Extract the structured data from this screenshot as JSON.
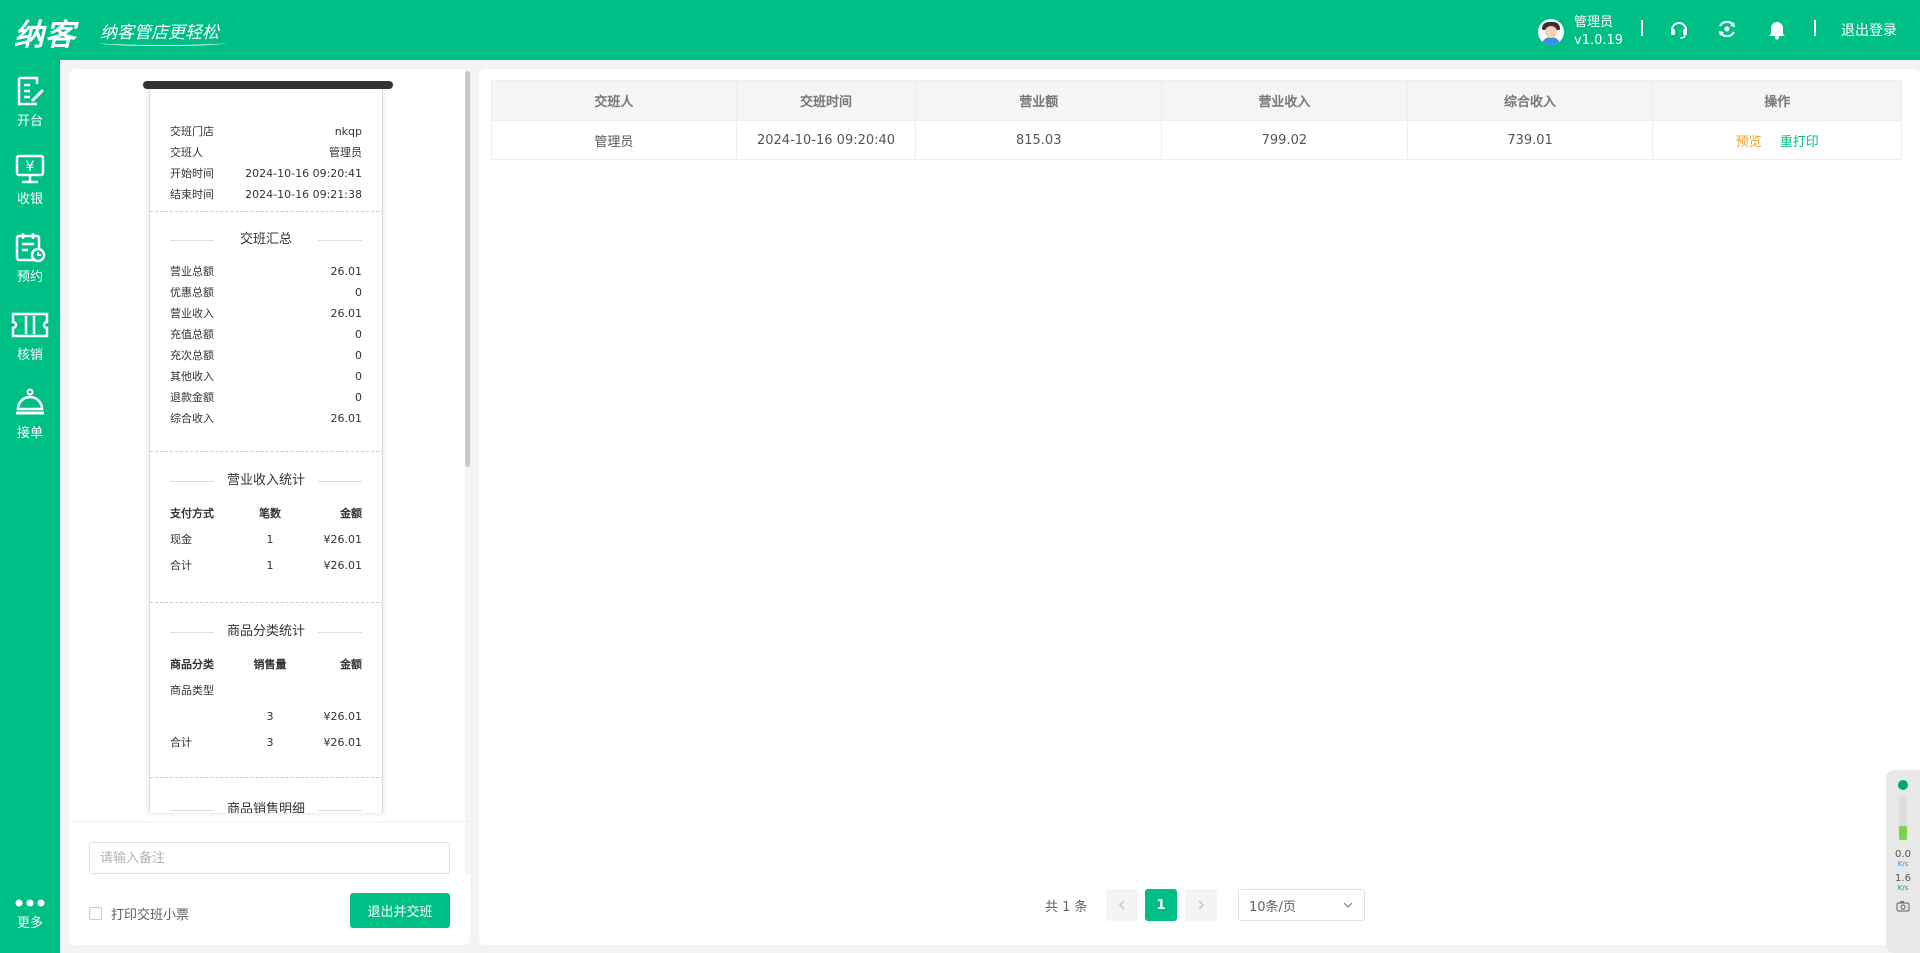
{
  "header": {
    "logo_text": "纳客",
    "slogan": "纳客管店更轻松",
    "user_name": "管理员",
    "version": "v1.0.19",
    "logout_label": "退出登录"
  },
  "sidebar": {
    "items": [
      {
        "label": "开台",
        "icon": "table-edit-icon"
      },
      {
        "label": "收银",
        "icon": "cashier-icon"
      },
      {
        "label": "预约",
        "icon": "reservation-icon"
      },
      {
        "label": "核销",
        "icon": "ticket-icon"
      },
      {
        "label": "接单",
        "icon": "bell-service-icon"
      }
    ],
    "more_label": "更多"
  },
  "receipt": {
    "info": [
      {
        "label": "交班门店",
        "value": "nkqp"
      },
      {
        "label": "交班人",
        "value": "管理员"
      },
      {
        "label": "开始时间",
        "value": "2024-10-16 09:20:41"
      },
      {
        "label": "结束时间",
        "value": "2024-10-16 09:21:38"
      }
    ],
    "summary_title": "交班汇总",
    "summary": [
      {
        "label": "营业总额",
        "value": "26.01"
      },
      {
        "label": "优惠总额",
        "value": "0"
      },
      {
        "label": "营业收入",
        "value": "26.01"
      },
      {
        "label": "充值总额",
        "value": "0"
      },
      {
        "label": "充次总额",
        "value": "0"
      },
      {
        "label": "其他收入",
        "value": "0"
      },
      {
        "label": "退款金额",
        "value": "0"
      },
      {
        "label": "综合收入",
        "value": "26.01"
      }
    ],
    "income_title": "营业收入统计",
    "income_headers": [
      "支付方式",
      "笔数",
      "金额"
    ],
    "income_rows": [
      [
        "现金",
        "1",
        "¥26.01"
      ],
      [
        "合计",
        "1",
        "¥26.01"
      ]
    ],
    "category_title": "商品分类统计",
    "category_headers": [
      "商品分类",
      "销售量",
      "金额"
    ],
    "category_group": "商品类型",
    "category_rows": [
      [
        "",
        "3",
        "¥26.01"
      ],
      [
        "合计",
        "3",
        "¥26.01"
      ]
    ],
    "sales_title": "商品销售明细"
  },
  "form": {
    "remark_placeholder": "请输入备注",
    "print_label": "打印交班小票",
    "print_checked": false,
    "exit_button": "退出并交班"
  },
  "table": {
    "headers": [
      "交班人",
      "交班时间",
      "营业额",
      "营业收入",
      "综合收入",
      "操作"
    ],
    "rows": [
      {
        "person": "管理员",
        "time": "2024-10-16 09:20:40",
        "turnover": "815.03",
        "revenue": "799.02",
        "total": "739.01",
        "preview": "预览",
        "reprint": "重打印"
      }
    ]
  },
  "pagination": {
    "total_text": "共 1 条",
    "current_page": "1",
    "page_size": "10条/页"
  },
  "net_widget": {
    "up": "0.0",
    "down": "1.6",
    "unit": "K/s"
  },
  "colors": {
    "brand": "#00bf86",
    "warning": "#f0a032"
  }
}
